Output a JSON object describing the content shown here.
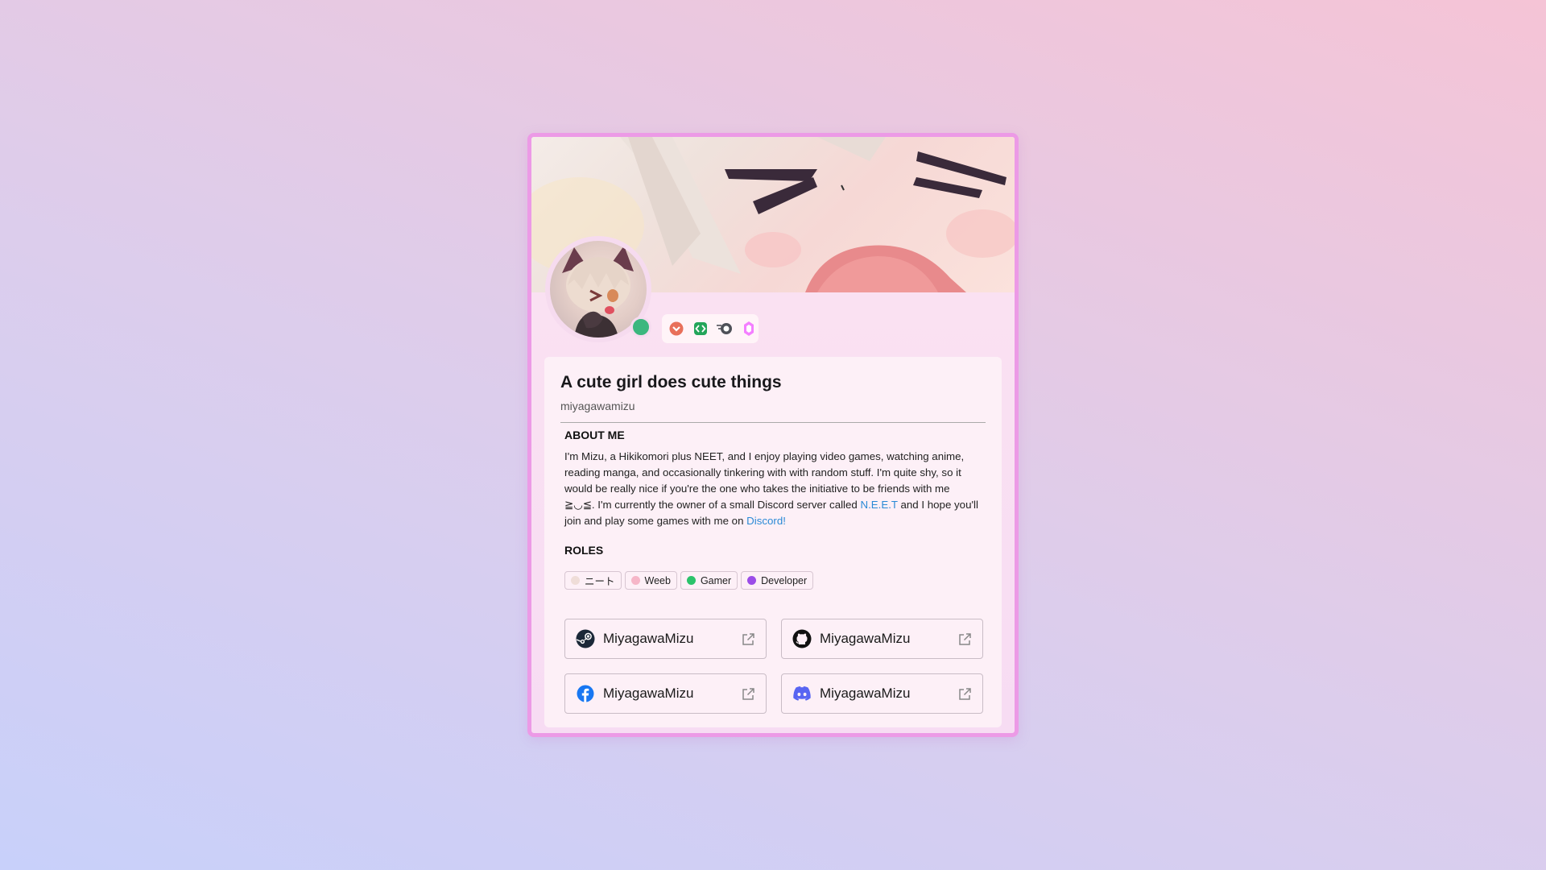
{
  "profile": {
    "title": "A cute girl does cute things",
    "username": "miyagawamizu",
    "status_color": "#3bb77e"
  },
  "badges": [
    {
      "name": "hypesquad-badge-icon",
      "color": "#e8705a"
    },
    {
      "name": "active-developer-badge-icon",
      "color": "#23a55a"
    },
    {
      "name": "quest-badge-icon",
      "color": "#4e5058"
    },
    {
      "name": "nitro-boost-badge-icon",
      "color": "#f47fff"
    }
  ],
  "about": {
    "heading": "ABOUT ME",
    "text_1": "I'm Mizu, a Hikikomori plus NEET, and I enjoy playing video games, watching anime, reading manga, and occasionally tinkering with with random stuff. I'm quite shy, so it would be really nice if you're the one who takes the initiative to be friends with me ≧◡≦. I'm currently the owner of a small Discord server called ",
    "link_1": "N.E.E.T",
    "text_2": " and I hope you'll join and play some games with me on ",
    "link_2": "Discord!"
  },
  "roles": {
    "heading": "ROLES",
    "items": [
      {
        "label": "ニート",
        "color": "#efddd8"
      },
      {
        "label": "Weeb",
        "color": "#f6b6c8"
      },
      {
        "label": "Gamer",
        "color": "#2bc36b"
      },
      {
        "label": "Developer",
        "color": "#9b4de8"
      }
    ]
  },
  "links": [
    {
      "service": "steam",
      "label": "MiyagawaMizu"
    },
    {
      "service": "github",
      "label": "MiyagawaMizu"
    },
    {
      "service": "facebook",
      "label": "MiyagawaMizu"
    },
    {
      "service": "discord",
      "label": "MiyagawaMizu"
    }
  ],
  "colors": {
    "card_border": "#ec9ae6",
    "link_color": "#2a8ad6",
    "facebook": "#1877f2",
    "discord": "#5865f2"
  }
}
